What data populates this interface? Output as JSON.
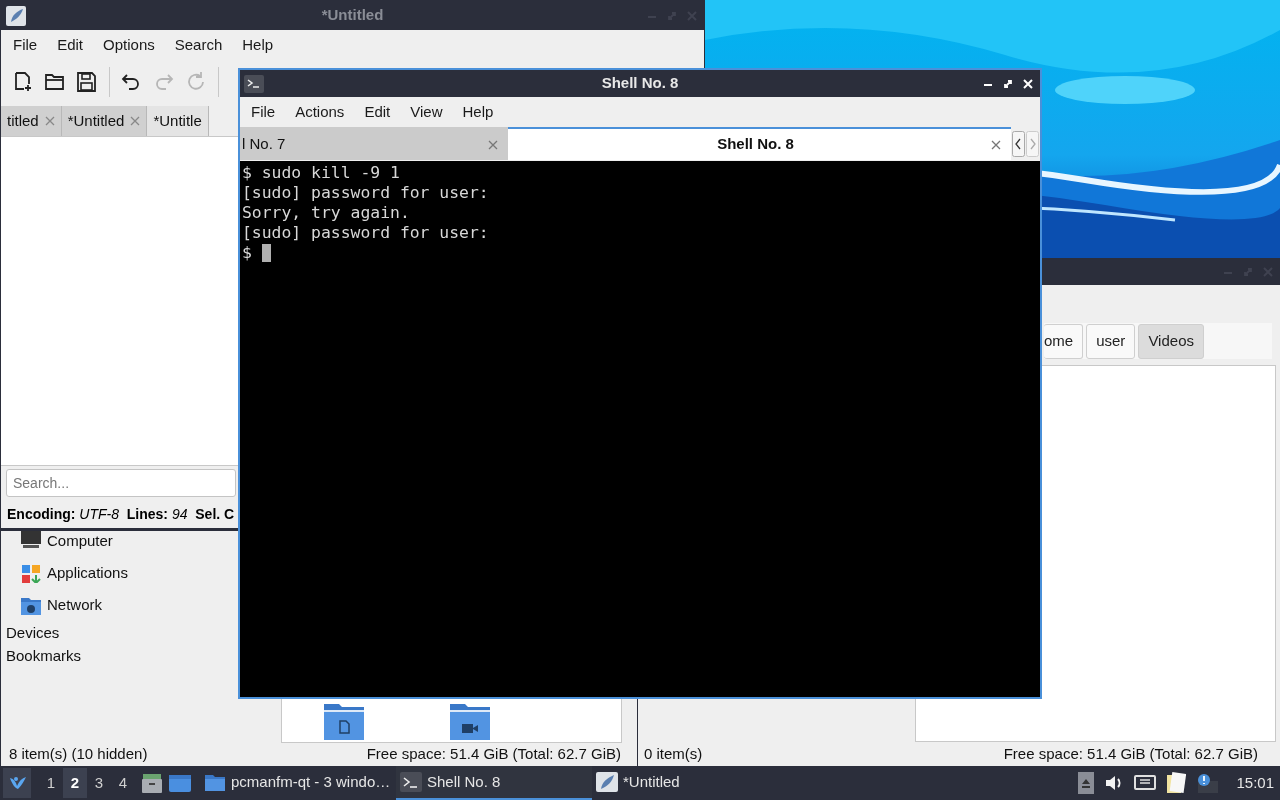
{
  "editor": {
    "title": "*Untitled",
    "active": false,
    "menu": [
      "File",
      "Edit",
      "Options",
      "Search",
      "Help"
    ],
    "toolbar": [
      {
        "kind": "new",
        "disabled": false
      },
      {
        "kind": "open",
        "disabled": false
      },
      {
        "kind": "save",
        "disabled": false
      },
      {
        "kind": "separator"
      },
      {
        "kind": "undo",
        "disabled": false
      },
      {
        "kind": "redo",
        "disabled": true
      },
      {
        "kind": "reload",
        "disabled": true
      },
      {
        "kind": "separator"
      }
    ],
    "tabs": [
      {
        "label": "titled",
        "selected": false,
        "closable": true
      },
      {
        "label": "*Untitled",
        "selected": false,
        "closable": true
      },
      {
        "label": "*Untitle",
        "selected": true,
        "closable": false
      }
    ],
    "search": {
      "placeholder": "Search..."
    },
    "status": "**Encoding:** *UTF-8*  **Lines:** *94*  **Sel. C**"
  },
  "file_manager_left": {
    "places": [
      {
        "label": "Computer",
        "kind": "computer"
      },
      {
        "label": "Applications",
        "kind": "applications"
      },
      {
        "label": "Network",
        "kind": "network"
      }
    ],
    "sections": [
      "Devices",
      "Bookmarks"
    ],
    "files": [
      {
        "kind": "documents"
      },
      {
        "kind": "videos"
      }
    ],
    "status_left": "8 item(s) (10 hidden)",
    "status_right": "Free space: 51.4 GiB (Total: 62.7 GiB)"
  },
  "file_manager_right": {
    "active": false,
    "path": [
      {
        "label": "ome",
        "selected": false
      },
      {
        "label": "user",
        "selected": false
      },
      {
        "label": "Videos",
        "selected": true
      }
    ],
    "status_left": "0 item(s)",
    "status_right": "Free space: 51.4 GiB (Total: 62.7 GiB)"
  },
  "terminal": {
    "title": "Shell No. 8",
    "active": true,
    "menu": [
      "File",
      "Actions",
      "Edit",
      "View",
      "Help"
    ],
    "tabs": [
      {
        "label": "l No. 7",
        "selected": false
      },
      {
        "label": "Shell No. 8",
        "selected": true
      }
    ],
    "lines": [
      "$ sudo kill -9 1",
      "[sudo] password for user:",
      "Sorry, try again.",
      "[sudo] password for user:"
    ],
    "prompt": "$ "
  },
  "taskbar": {
    "desktops": [
      {
        "label": "1",
        "selected": false
      },
      {
        "label": "2",
        "selected": true
      },
      {
        "label": "3",
        "selected": false
      },
      {
        "label": "4",
        "selected": false
      }
    ],
    "tasks": [
      {
        "label": "pcmanfm-qt - 3 windo…",
        "kind": "folder",
        "selected": false
      },
      {
        "label": "Shell No. 8",
        "kind": "terminal",
        "selected": true
      },
      {
        "label": "*Untitled",
        "kind": "editor",
        "selected": false
      }
    ],
    "clock": "15:01"
  }
}
